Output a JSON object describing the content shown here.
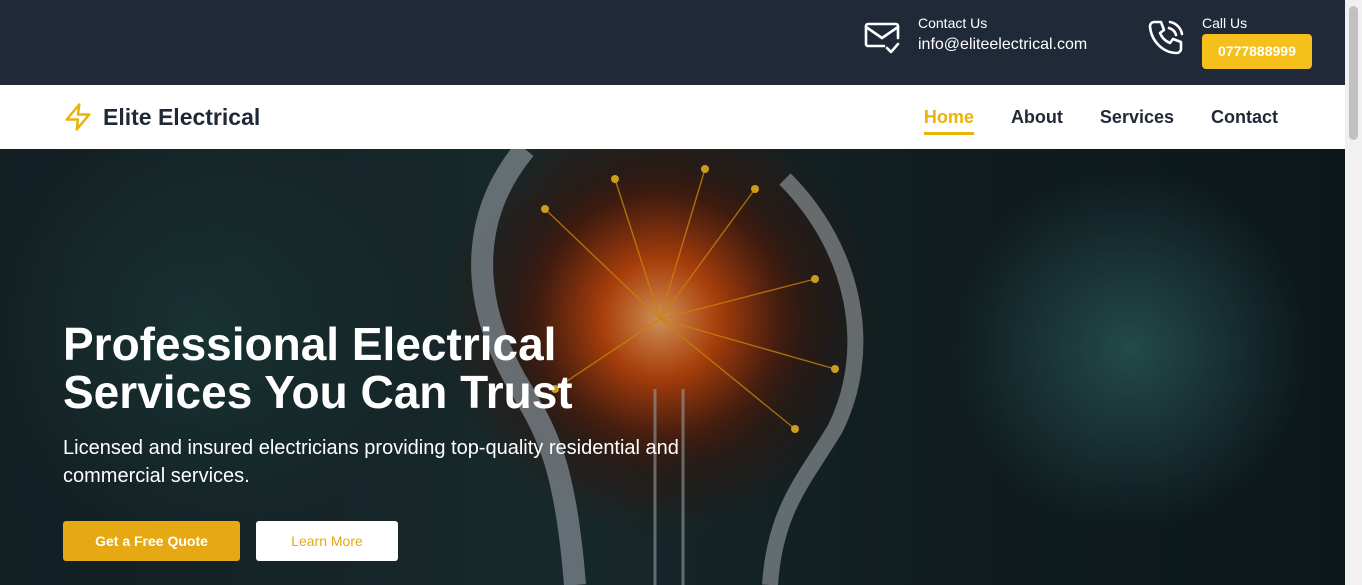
{
  "topbar": {
    "email": {
      "label": "Contact Us",
      "value": "info@eliteelectrical.com",
      "icon": "mail-check-icon"
    },
    "phone": {
      "label": "Call Us",
      "value": "0777888999",
      "icon": "phone-call-icon"
    }
  },
  "navbar": {
    "brand": "Elite Electrical",
    "brand_icon": "lightning-bolt-icon",
    "links": [
      "Home",
      "About",
      "Services",
      "Contact"
    ],
    "active": "Home"
  },
  "hero": {
    "title_line1": "Professional Electrical",
    "title_line2": "Services You Can Trust",
    "subtitle_line1": "Licensed and insured electricians providing top-quality residential and",
    "subtitle_line2": "commercial services.",
    "primary_button": "Get a Free Quote",
    "secondary_button": "Learn More"
  },
  "colors": {
    "accent": "#eab308",
    "dark": "#1f2937",
    "white": "#ffffff"
  }
}
